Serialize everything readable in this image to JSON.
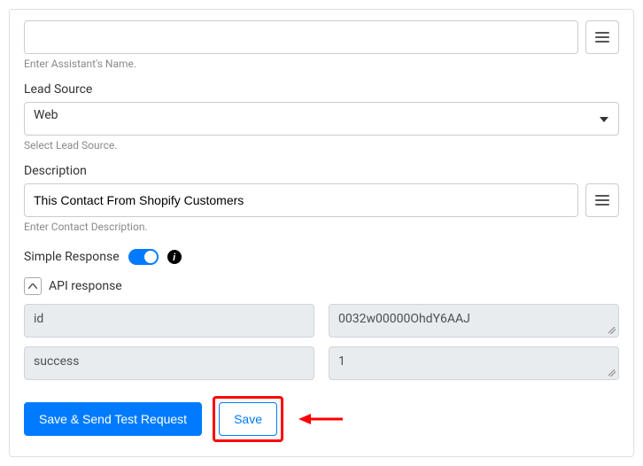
{
  "assistant": {
    "value": "",
    "helper": "Enter Assistant's Name."
  },
  "leadSource": {
    "label": "Lead Source",
    "value": "Web",
    "helper": "Select Lead Source."
  },
  "description": {
    "label": "Description",
    "value": "This Contact From Shopify Customers",
    "helper": "Enter Contact Description."
  },
  "simpleResponse": {
    "label": "Simple Response",
    "enabled": true
  },
  "apiResponse": {
    "label": "API response",
    "rows": [
      {
        "key": "id",
        "value": "0032w00000OhdY6AAJ"
      },
      {
        "key": "success",
        "value": "1"
      }
    ]
  },
  "buttons": {
    "saveTest": "Save & Send Test Request",
    "save": "Save"
  }
}
